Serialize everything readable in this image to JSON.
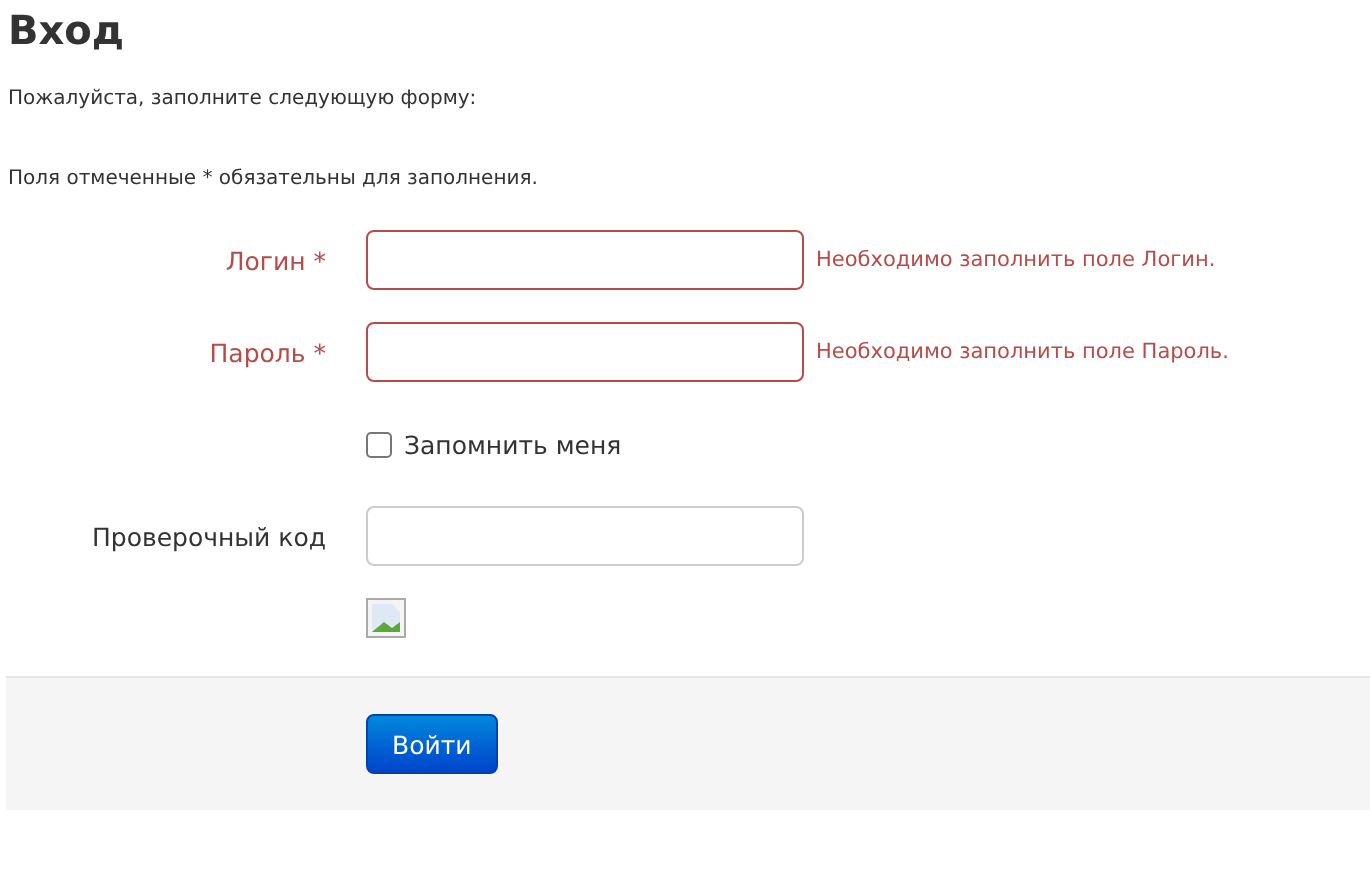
{
  "title": "Вход",
  "intro": "Пожалуйста, заполните следующую форму:",
  "note": "Поля отмеченные * обязательны для заполнения.",
  "fields": [
    {
      "kind": "text",
      "label": "Логин *",
      "error": "Необходимо заполнить поле Логин."
    },
    {
      "kind": "text",
      "label": "Пароль *",
      "error": "Необходимо заполнить поле Пароль."
    },
    {
      "kind": "checkbox",
      "label": "Запомнить меня",
      "checked": false
    },
    {
      "kind": "text",
      "label": "Проверочный код"
    },
    {
      "kind": "image"
    }
  ],
  "submit": "Войти"
}
